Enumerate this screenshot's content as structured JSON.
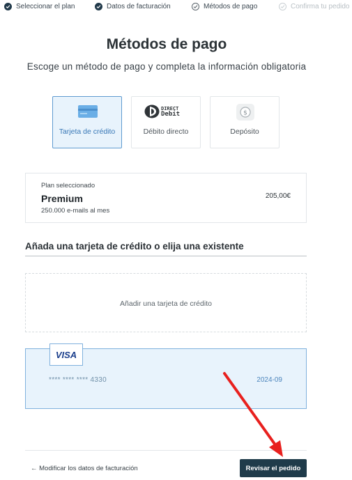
{
  "stepper": {
    "steps": [
      {
        "label": "Seleccionar el plan",
        "state": "done"
      },
      {
        "label": "Datos de facturación",
        "state": "done"
      },
      {
        "label": "Métodos de pago",
        "state": "current"
      },
      {
        "label": "Confirma tu pedido",
        "state": "future"
      }
    ]
  },
  "header": {
    "title": "Métodos de pago",
    "subtitle": "Escoge un método de pago y completa la información obligatoria"
  },
  "methods": [
    {
      "label": "Tarjeta de crédito",
      "icon": "credit-card-icon",
      "selected": true
    },
    {
      "label": "Débito directo",
      "icon": "direct-debit-logo",
      "logo_text_1": "DIRECT",
      "logo_text_2": "Debit",
      "selected": false
    },
    {
      "label": "Depósito",
      "icon": "dollar-coin-icon",
      "selected": false
    }
  ],
  "plan": {
    "caption": "Plan seleccionado",
    "name": "Premium",
    "description": "250.000 e-mails al mes",
    "price": "205,00€"
  },
  "cards_section": {
    "title": "Añada una tarjeta de crédito o elija una existente",
    "add_card_label": "Añadir una tarjeta de crédito",
    "saved_card": {
      "brand": "VISA",
      "number": "**** **** **** 4330",
      "expiry": "2024-09"
    }
  },
  "footer": {
    "back_label": "← Modificar los datos de facturación",
    "review_label": "Revisar el pedido"
  },
  "colors": {
    "accent": "#1f3b4a",
    "selected_bg": "#e8f3fc",
    "selected_border": "#5e9ad0",
    "arrow": "#e8201e"
  }
}
